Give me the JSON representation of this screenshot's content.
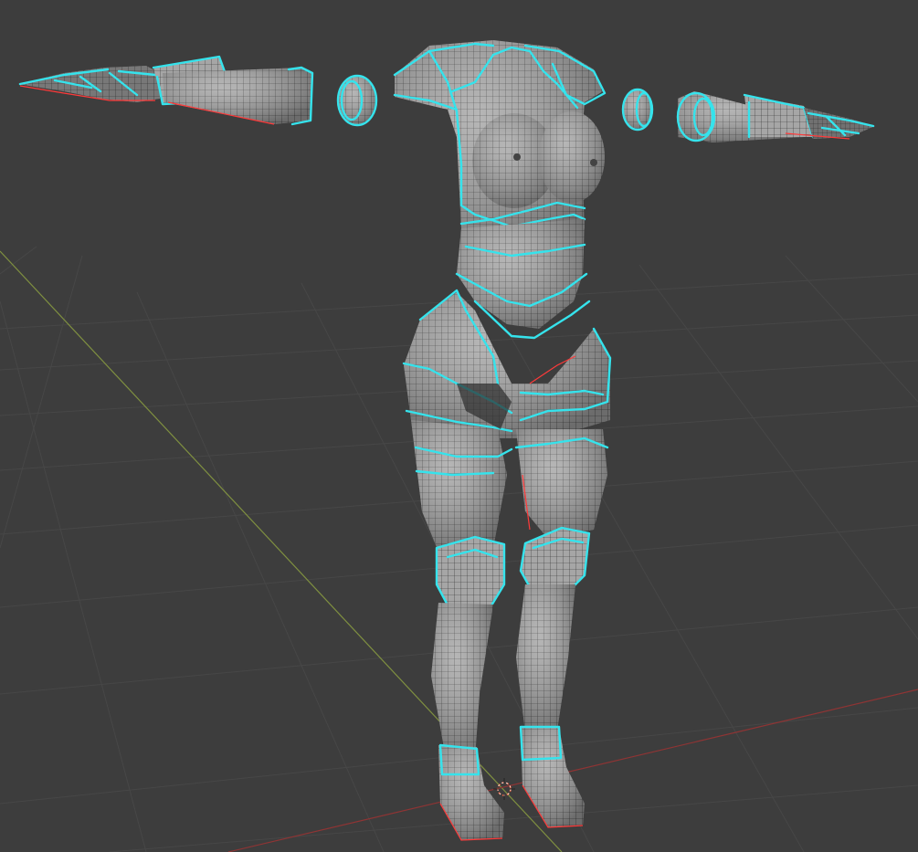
{
  "viewport": {
    "background": "#3d3d3d",
    "grid_color": "#464646",
    "y_axis_color": "#8a9a46",
    "x_axis_color": "#9b3b3b"
  },
  "mesh": {
    "surface_color": "#a4a4a4",
    "wire_color": "#1f1f1f",
    "seam_color": "#35e3ec",
    "sharp_edge_color": "#ff3a3a"
  },
  "icons": {
    "origin": "3d-cursor-icon"
  }
}
